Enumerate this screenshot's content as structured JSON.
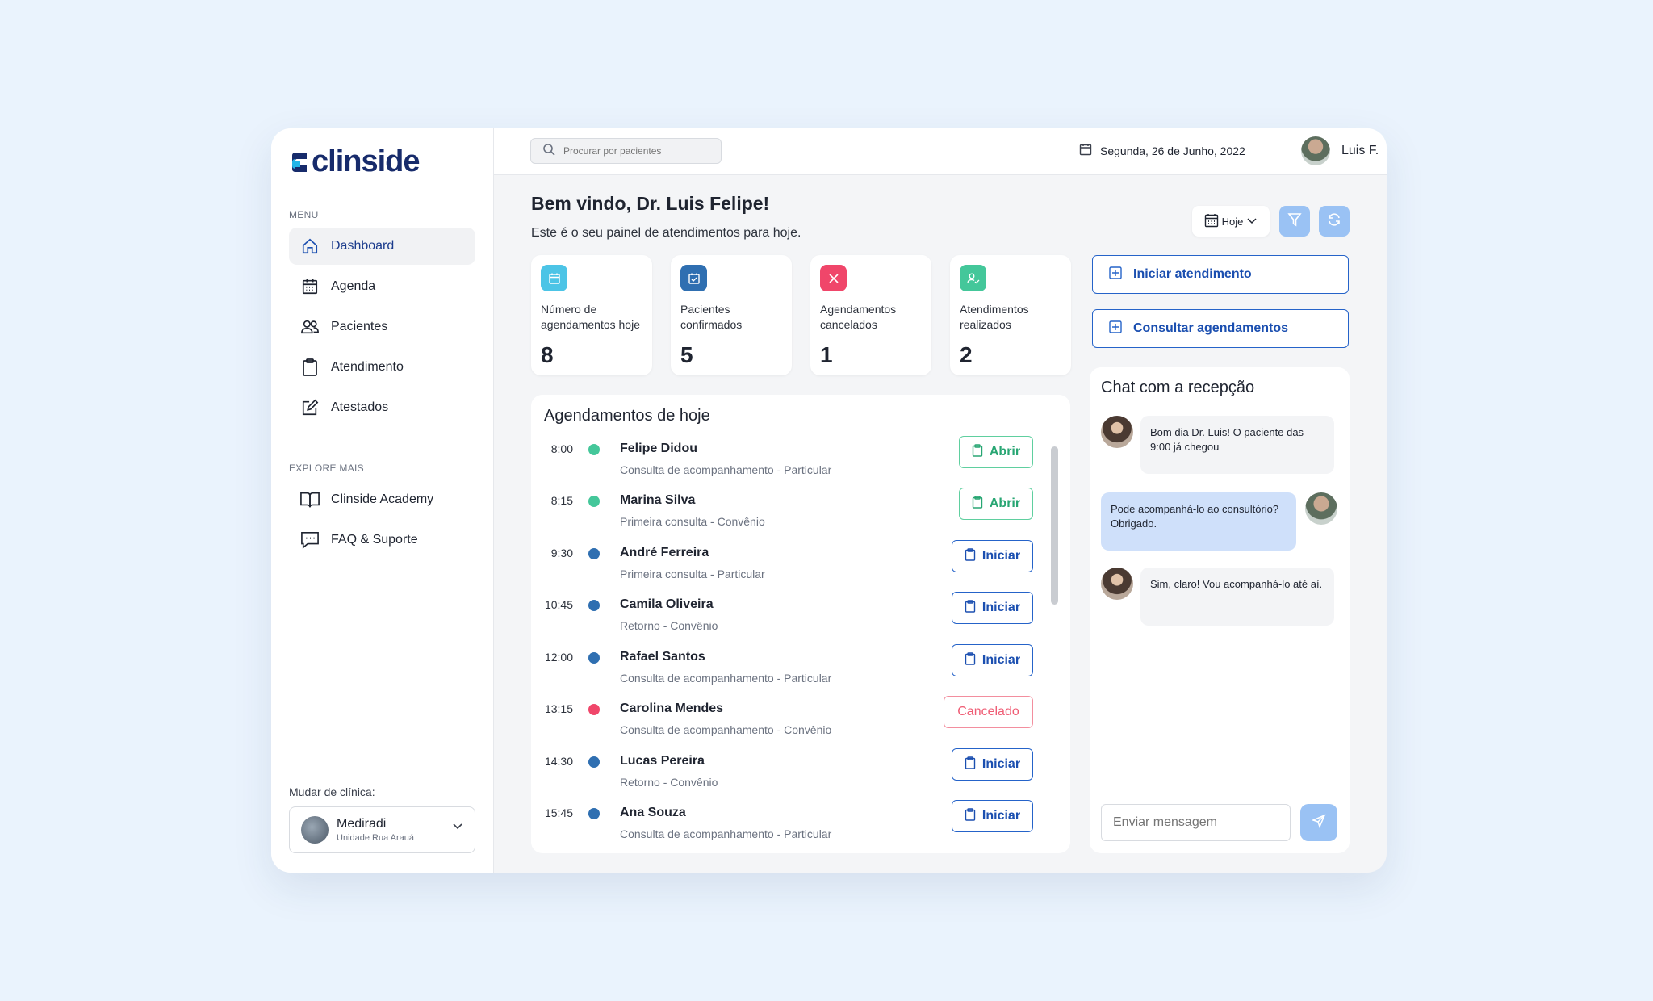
{
  "brand": {
    "name": "clinside",
    "colors": {
      "primary": "#172b6b",
      "accent": "#1b4fb0",
      "cyan": "#22b5e8"
    }
  },
  "sidebar": {
    "menu_label": "MENU",
    "items": [
      {
        "label": "Dashboard",
        "icon": "home-icon",
        "active": true
      },
      {
        "label": "Agenda",
        "icon": "calendar-icon"
      },
      {
        "label": "Pacientes",
        "icon": "users-icon"
      },
      {
        "label": "Atendimento",
        "icon": "clipboard-icon"
      },
      {
        "label": "Atestados",
        "icon": "edit-icon"
      }
    ],
    "explore_label": "EXPLORE MAIS",
    "explore": [
      {
        "label": "Clinside Academy",
        "icon": "book-icon"
      },
      {
        "label": "FAQ & Suporte",
        "icon": "chat-support-icon"
      }
    ],
    "clinic_label": "Mudar de clínica:",
    "clinic": {
      "name": "Mediradi",
      "unit": "Unidade Rua Arauá"
    }
  },
  "topbar": {
    "search_placeholder": "Procurar por pacientes",
    "date": "Segunda, 26 de Junho, 2022",
    "user": "Luis F."
  },
  "main": {
    "welcome": "Bem vindo, Dr. Luis Felipe!",
    "subtitle": "Este é o seu painel de atendimentos para hoje.",
    "period": "Hoje",
    "stats": [
      {
        "label": "Número de agendamentos hoje",
        "value": "8",
        "color": "#4cc4e6",
        "icon": "calendar-icon"
      },
      {
        "label": "Pacientes confirmados",
        "value": "5",
        "color": "#2f6fb1",
        "icon": "check-calendar-icon"
      },
      {
        "label": "Agendamentos cancelados",
        "value": "1",
        "color": "#f0466a",
        "icon": "x-icon"
      },
      {
        "label": "Atendimentos realizados",
        "value": "2",
        "color": "#44c79a",
        "icon": "user-check-icon"
      }
    ],
    "actions": {
      "start": "Iniciar atendimento",
      "consult": "Consultar agendamentos"
    }
  },
  "appointments": {
    "title": "Agendamentos de hoje",
    "rows": [
      {
        "time": "8:00",
        "name": "Felipe Didou",
        "desc": "Consulta de acompanhamento - Particular",
        "status": "done",
        "action": "Abrir"
      },
      {
        "time": "8:15",
        "name": "Marina Silva",
        "desc": "Primeira consulta - Convênio",
        "status": "done",
        "action": "Abrir"
      },
      {
        "time": "9:30",
        "name": "André Ferreira",
        "desc": "Primeira consulta - Particular",
        "status": "pending",
        "action": "Iniciar"
      },
      {
        "time": "10:45",
        "name": "Camila Oliveira",
        "desc": "Retorno - Convênio",
        "status": "pending",
        "action": "Iniciar"
      },
      {
        "time": "12:00",
        "name": "Rafael Santos",
        "desc": "Consulta de acompanhamento - Particular",
        "status": "pending",
        "action": "Iniciar"
      },
      {
        "time": "13:15",
        "name": "Carolina Mendes",
        "desc": "Consulta de acompanhamento - Convênio",
        "status": "cancelled",
        "action": "Cancelado"
      },
      {
        "time": "14:30",
        "name": "Lucas Pereira",
        "desc": "Retorno - Convênio",
        "status": "pending",
        "action": "Iniciar"
      },
      {
        "time": "15:45",
        "name": "Ana Souza",
        "desc": "Consulta de acompanhamento - Particular",
        "status": "pending",
        "action": "Iniciar"
      }
    ]
  },
  "chat": {
    "title": "Chat com a recepção",
    "messages": [
      {
        "from": "reception",
        "text": "Bom dia Dr. Luis! O paciente das 9:00 já chegou"
      },
      {
        "from": "doctor",
        "text": "Pode acompanhá-lo ao consultório? Obrigado."
      },
      {
        "from": "reception",
        "text": "Sim, claro! Vou acompanhá-lo até aí."
      }
    ],
    "input_placeholder": "Enviar mensagem"
  }
}
